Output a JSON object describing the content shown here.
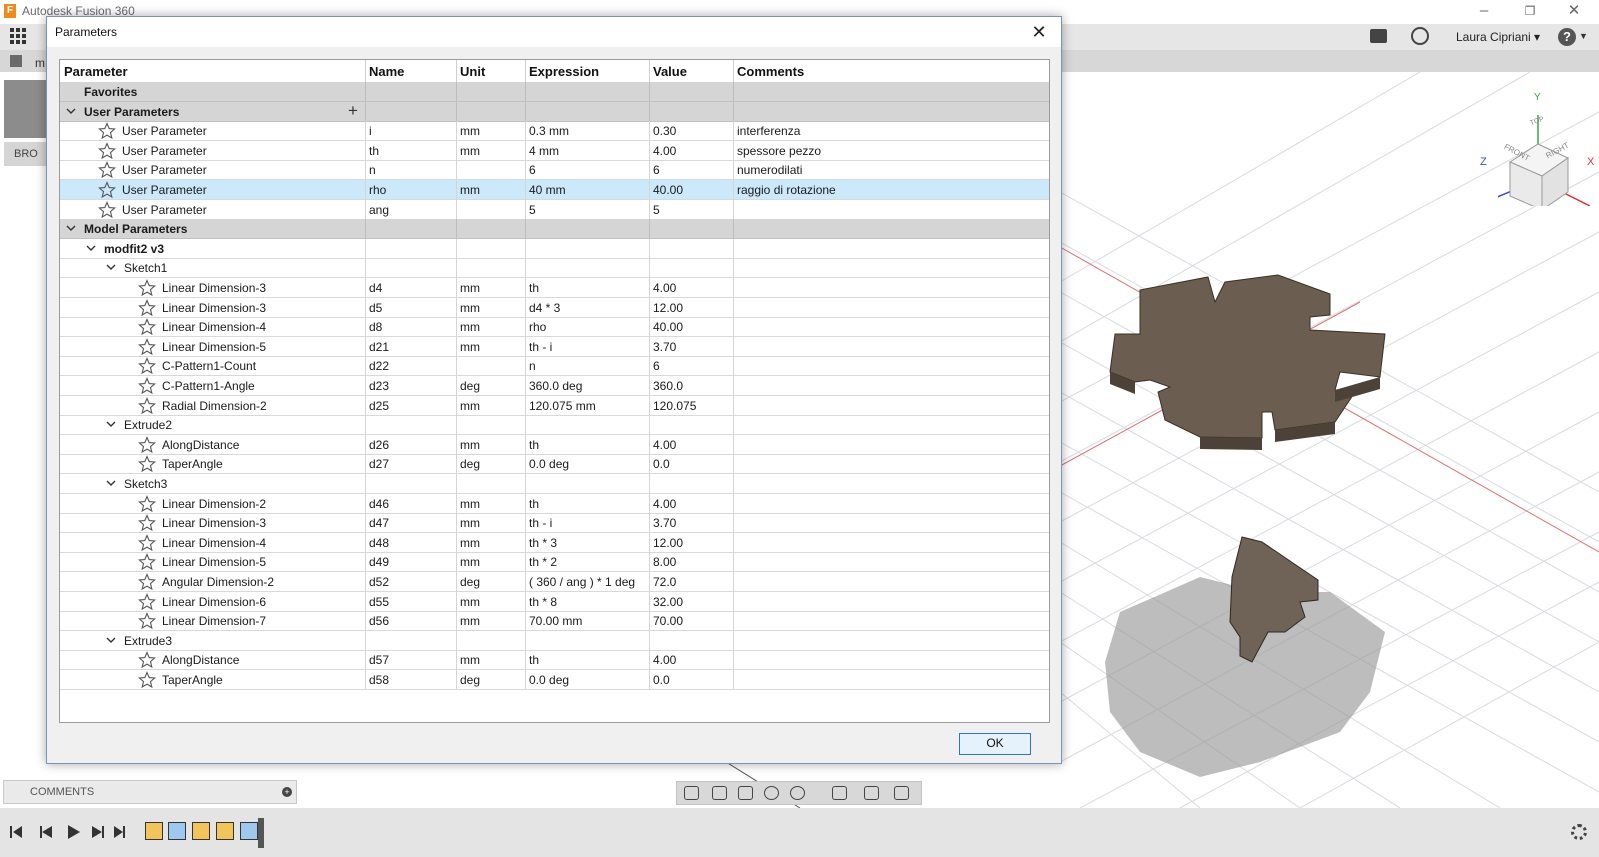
{
  "app": {
    "title": "Autodesk Fusion 360",
    "logo_letter": "F",
    "user": "Laura Cipriani ▾",
    "doc_tab": "m",
    "help": "?",
    "browser_label": "BRO",
    "comments_label": "COMMENTS",
    "window_controls": [
      "–",
      "❐",
      "✕"
    ]
  },
  "viewcube": {
    "top": "TOP",
    "front": "FRONT",
    "right": "RIGHT",
    "axis_x": "X",
    "axis_y": "Y",
    "axis_z": "Z"
  },
  "dialog": {
    "title": "Parameters",
    "ok_label": "OK",
    "columns": [
      "Parameter",
      "Name",
      "Unit",
      "Expression",
      "Value",
      "Comments"
    ],
    "rows": [
      {
        "level": 0,
        "kind": "section",
        "toggle": "",
        "label": "Favorites"
      },
      {
        "level": 0,
        "kind": "section",
        "toggle": "v",
        "label": "User Parameters",
        "add": "+"
      },
      {
        "level": 1,
        "kind": "param",
        "label": "User Parameter",
        "name": "i",
        "unit": "mm",
        "expression": "0.3 mm",
        "value": "0.30",
        "comment": "interferenza"
      },
      {
        "level": 1,
        "kind": "param",
        "label": "User Parameter",
        "name": "th",
        "unit": "mm",
        "expression": "4 mm",
        "value": "4.00",
        "comment": "spessore pezzo"
      },
      {
        "level": 1,
        "kind": "param",
        "label": "User Parameter",
        "name": "n",
        "unit": "",
        "expression": "6",
        "value": "6",
        "comment": "numerodilati"
      },
      {
        "level": 1,
        "kind": "param",
        "label": "User Parameter",
        "name": "rho",
        "unit": "mm",
        "expression": "40 mm",
        "value": "40.00",
        "comment": "raggio di rotazione",
        "selected": true
      },
      {
        "level": 1,
        "kind": "param",
        "label": "User Parameter",
        "name": "ang",
        "unit": "",
        "expression": "5",
        "value": "5",
        "comment": ""
      },
      {
        "level": 0,
        "kind": "section",
        "toggle": "v",
        "label": "Model Parameters"
      },
      {
        "level": 1,
        "kind": "group",
        "toggle": "v",
        "label": "modfit2 v3",
        "bold": true
      },
      {
        "level": 2,
        "kind": "group",
        "toggle": "v",
        "label": "Sketch1"
      },
      {
        "level": 3,
        "kind": "param",
        "label": "Linear Dimension-3",
        "name": "d4",
        "unit": "mm",
        "expression": "th",
        "value": "4.00",
        "comment": ""
      },
      {
        "level": 3,
        "kind": "param",
        "label": "Linear Dimension-3",
        "name": "d5",
        "unit": "mm",
        "expression": "d4 * 3",
        "value": "12.00",
        "comment": ""
      },
      {
        "level": 3,
        "kind": "param",
        "label": "Linear Dimension-4",
        "name": "d8",
        "unit": "mm",
        "expression": "rho",
        "value": "40.00",
        "comment": ""
      },
      {
        "level": 3,
        "kind": "param",
        "label": "Linear Dimension-5",
        "name": "d21",
        "unit": "mm",
        "expression": "th - i",
        "value": "3.70",
        "comment": ""
      },
      {
        "level": 3,
        "kind": "param",
        "label": "C-Pattern1-Count",
        "name": "d22",
        "unit": "",
        "expression": "n",
        "value": "6",
        "comment": ""
      },
      {
        "level": 3,
        "kind": "param",
        "label": "C-Pattern1-Angle",
        "name": "d23",
        "unit": "deg",
        "expression": "360.0 deg",
        "value": "360.0",
        "comment": ""
      },
      {
        "level": 3,
        "kind": "param",
        "label": "Radial Dimension-2",
        "name": "d25",
        "unit": "mm",
        "expression": "120.075 mm",
        "value": "120.075",
        "comment": ""
      },
      {
        "level": 2,
        "kind": "group",
        "toggle": "v",
        "label": "Extrude2"
      },
      {
        "level": 3,
        "kind": "param",
        "label": "AlongDistance",
        "name": "d26",
        "unit": "mm",
        "expression": "th",
        "value": "4.00",
        "comment": ""
      },
      {
        "level": 3,
        "kind": "param",
        "label": "TaperAngle",
        "name": "d27",
        "unit": "deg",
        "expression": "0.0 deg",
        "value": "0.0",
        "comment": ""
      },
      {
        "level": 2,
        "kind": "group",
        "toggle": "v",
        "label": "Sketch3"
      },
      {
        "level": 3,
        "kind": "param",
        "label": "Linear Dimension-2",
        "name": "d46",
        "unit": "mm",
        "expression": "th",
        "value": "4.00",
        "comment": ""
      },
      {
        "level": 3,
        "kind": "param",
        "label": "Linear Dimension-3",
        "name": "d47",
        "unit": "mm",
        "expression": "th - i",
        "value": "3.70",
        "comment": ""
      },
      {
        "level": 3,
        "kind": "param",
        "label": "Linear Dimension-4",
        "name": "d48",
        "unit": "mm",
        "expression": "th * 3",
        "value": "12.00",
        "comment": ""
      },
      {
        "level": 3,
        "kind": "param",
        "label": "Linear Dimension-5",
        "name": "d49",
        "unit": "mm",
        "expression": "th * 2",
        "value": "8.00",
        "comment": ""
      },
      {
        "level": 3,
        "kind": "param",
        "label": "Angular Dimension-2",
        "name": "d52",
        "unit": "deg",
        "expression": "( 360 / ang ) * 1 deg",
        "value": "72.0",
        "comment": ""
      },
      {
        "level": 3,
        "kind": "param",
        "label": "Linear Dimension-6",
        "name": "d55",
        "unit": "mm",
        "expression": "th * 8",
        "value": "32.00",
        "comment": ""
      },
      {
        "level": 3,
        "kind": "param",
        "label": "Linear Dimension-7",
        "name": "d56",
        "unit": "mm",
        "expression": "70.00 mm",
        "value": "70.00",
        "comment": ""
      },
      {
        "level": 2,
        "kind": "group",
        "toggle": "v",
        "label": "Extrude3"
      },
      {
        "level": 3,
        "kind": "param",
        "label": "AlongDistance",
        "name": "d57",
        "unit": "mm",
        "expression": "th",
        "value": "4.00",
        "comment": ""
      },
      {
        "level": 3,
        "kind": "param",
        "label": "TaperAngle",
        "name": "d58",
        "unit": "deg",
        "expression": "0.0 deg",
        "value": "0.0",
        "comment": ""
      }
    ]
  },
  "colors": {
    "selection": "#cce8fb",
    "section": "#d5d5d5",
    "ok_border": "#2b76c8",
    "model_face": "#6b5d4f",
    "axis_red": "#e03030",
    "axis_green": "#2fae3a",
    "axis_blue": "#3050d0"
  }
}
